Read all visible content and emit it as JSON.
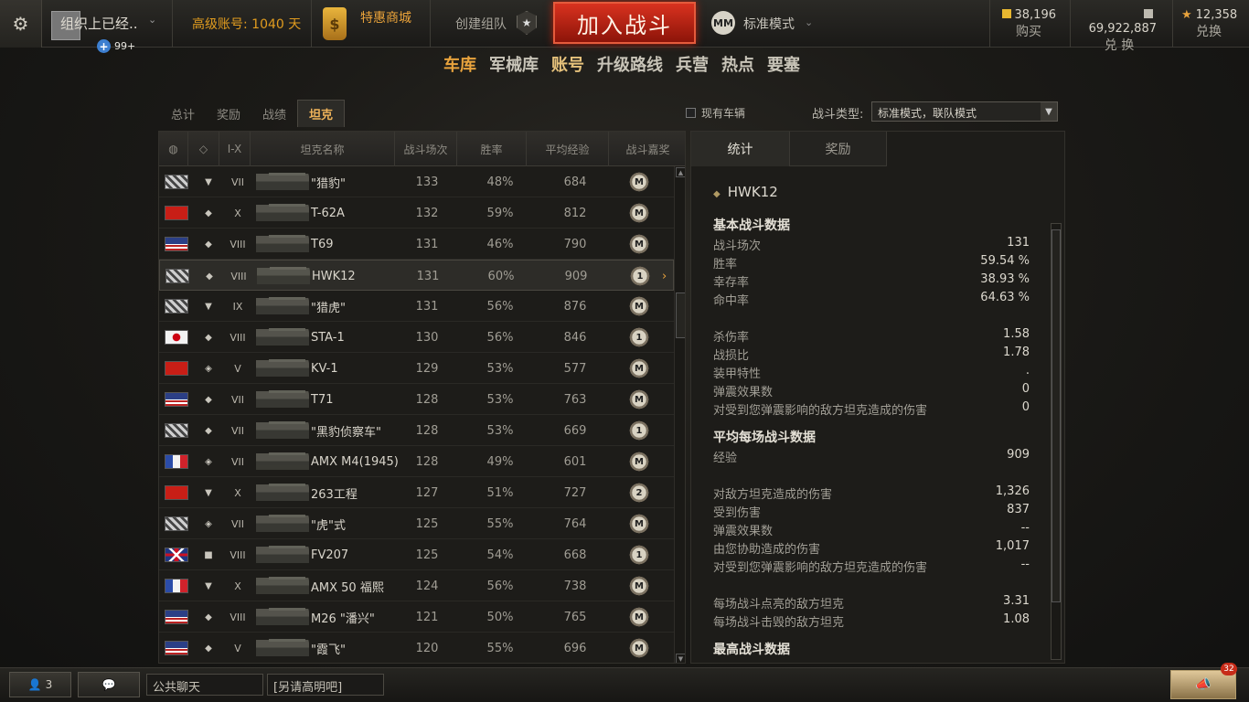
{
  "topbar": {
    "clan_name": "组织上已经..",
    "invites": "99+",
    "premium_label": "高级账号:",
    "premium_days": "1040 天",
    "shop_label": "特惠商城",
    "create_squad": "创建组队",
    "battle_button": "加入战斗",
    "mode_icon_text": "MM",
    "mode_label": "标准模式",
    "gold_value": "38,196",
    "gold_label": "购买",
    "credits_value": "69,922,887",
    "credits_label": "兑 换",
    "xp_value": "12,358",
    "xp_label": "兑换"
  },
  "nav": [
    "车库",
    "军械库",
    "账号",
    "升级路线",
    "兵营",
    "热点",
    "要塞"
  ],
  "subtabs": [
    "总计",
    "奖励",
    "战绩",
    "坦克"
  ],
  "filter": {
    "label": "现有车辆"
  },
  "battle_type": {
    "label": "战斗类型:",
    "value": "标准模式，联队模式"
  },
  "table": {
    "headers": {
      "tier": "I-X",
      "name": "坦克名称",
      "battles": "战斗场次",
      "winrate": "胜率",
      "avgxp": "平均经验",
      "mastery": "战斗嘉奖"
    },
    "rows": [
      {
        "nation": "germany",
        "type": "▼",
        "tier": "VII",
        "name": "\"猎豹\"",
        "battles": "133",
        "winrate": "48%",
        "avgxp": "684",
        "mastery": "M"
      },
      {
        "nation": "ussr",
        "type": "◆",
        "tier": "X",
        "name": "T-62A",
        "battles": "132",
        "winrate": "59%",
        "avgxp": "812",
        "mastery": "M"
      },
      {
        "nation": "usa",
        "type": "◆",
        "tier": "VIII",
        "name": "T69",
        "battles": "131",
        "winrate": "46%",
        "avgxp": "790",
        "mastery": "M"
      },
      {
        "nation": "germany",
        "type": "◆",
        "tier": "VIII",
        "name": "HWK12",
        "battles": "131",
        "winrate": "60%",
        "avgxp": "909",
        "mastery": "1"
      },
      {
        "nation": "germany",
        "type": "▼",
        "tier": "IX",
        "name": "\"猎虎\"",
        "battles": "131",
        "winrate": "56%",
        "avgxp": "876",
        "mastery": "M"
      },
      {
        "nation": "japan",
        "type": "◆",
        "tier": "VIII",
        "name": "STA-1",
        "battles": "130",
        "winrate": "56%",
        "avgxp": "846",
        "mastery": "1"
      },
      {
        "nation": "ussr",
        "type": "◈",
        "tier": "V",
        "name": "KV-1",
        "battles": "129",
        "winrate": "53%",
        "avgxp": "577",
        "mastery": "M"
      },
      {
        "nation": "usa",
        "type": "◆",
        "tier": "VII",
        "name": "T71",
        "battles": "128",
        "winrate": "53%",
        "avgxp": "763",
        "mastery": "M"
      },
      {
        "nation": "germany",
        "type": "◆",
        "tier": "VII",
        "name": "\"黑豹侦察车\"",
        "battles": "128",
        "winrate": "53%",
        "avgxp": "669",
        "mastery": "1"
      },
      {
        "nation": "france",
        "type": "◈",
        "tier": "VII",
        "name": "AMX M4(1945)",
        "battles": "128",
        "winrate": "49%",
        "avgxp": "601",
        "mastery": "M"
      },
      {
        "nation": "ussr",
        "type": "▼",
        "tier": "X",
        "name": "263工程",
        "battles": "127",
        "winrate": "51%",
        "avgxp": "727",
        "mastery": "2"
      },
      {
        "nation": "germany",
        "type": "◈",
        "tier": "VII",
        "name": "\"虎\"式",
        "battles": "125",
        "winrate": "55%",
        "avgxp": "764",
        "mastery": "M"
      },
      {
        "nation": "uk",
        "type": "■",
        "tier": "VIII",
        "name": "FV207",
        "battles": "125",
        "winrate": "54%",
        "avgxp": "668",
        "mastery": "1"
      },
      {
        "nation": "france",
        "type": "▼",
        "tier": "X",
        "name": "AMX 50 福熙",
        "battles": "124",
        "winrate": "56%",
        "avgxp": "738",
        "mastery": "M"
      },
      {
        "nation": "usa",
        "type": "◆",
        "tier": "VIII",
        "name": "M26 \"潘兴\"",
        "battles": "121",
        "winrate": "50%",
        "avgxp": "765",
        "mastery": "M"
      },
      {
        "nation": "usa",
        "type": "◆",
        "tier": "V",
        "name": "\"霞飞\"",
        "battles": "120",
        "winrate": "55%",
        "avgxp": "696",
        "mastery": "M"
      }
    ]
  },
  "detail": {
    "tabs": [
      "统计",
      "奖励"
    ],
    "tank": "HWK12",
    "sections": [
      {
        "title": "基本战斗数据",
        "stats": [
          {
            "k": "战斗场次",
            "v": "131"
          },
          {
            "k": "胜率",
            "v": "59.54 %"
          },
          {
            "k": "幸存率",
            "v": "38.93 %"
          },
          {
            "k": "命中率",
            "v": "64.63 %"
          },
          {
            "k": "杀伤率",
            "v": "1.58"
          },
          {
            "k": "战损比",
            "v": "1.78"
          },
          {
            "k": "装甲特性",
            "v": "."
          },
          {
            "k": "弹震效果数",
            "v": "0"
          },
          {
            "k": "对受到您弹震影响的敌方坦克造成的伤害",
            "v": "0"
          }
        ]
      },
      {
        "title": "平均每场战斗数据",
        "stats": [
          {
            "k": "经验",
            "v": "909"
          },
          {
            "k": "对敌方坦克造成的伤害",
            "v": "1,326"
          },
          {
            "k": "受到伤害",
            "v": "837"
          },
          {
            "k": "弹震效果数",
            "v": "--"
          },
          {
            "k": "由您协助造成的伤害",
            "v": "1,017"
          },
          {
            "k": "对受到您弹震影响的敌方坦克造成的伤害",
            "v": "--"
          },
          {
            "k": "每场战斗点亮的敌方坦克",
            "v": "3.31"
          },
          {
            "k": "每场战斗击毁的敌方坦克",
            "v": "1.08"
          }
        ]
      },
      {
        "title": "最高战斗数据",
        "stats": []
      }
    ]
  },
  "bottombar": {
    "online_count": "3",
    "chat_channel": "公共聊天",
    "chat_channel2": "[另请高明吧]",
    "notif_count": "32"
  }
}
